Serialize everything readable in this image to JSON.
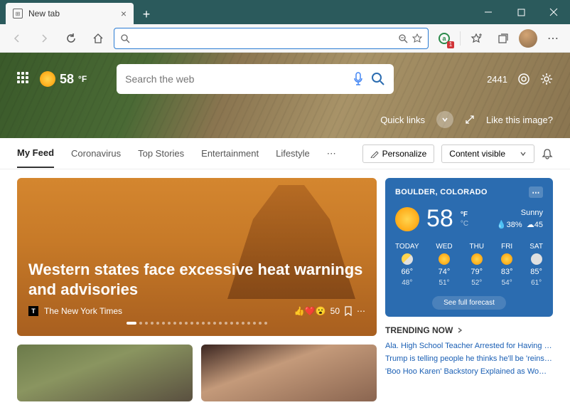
{
  "window": {
    "tab_title": "New tab"
  },
  "hero": {
    "temp": "58",
    "temp_unit": "°F",
    "search_placeholder": "Search the web",
    "points": "2441",
    "quick_links": "Quick links",
    "like_image": "Like this image?"
  },
  "nav": {
    "items": [
      "My Feed",
      "Coronavirus",
      "Top Stories",
      "Entertainment",
      "Lifestyle"
    ],
    "personalize": "Personalize",
    "content_visible": "Content visible"
  },
  "hero_card": {
    "headline": "Western states face excessive heat warnings and advisories",
    "source": "The New York Times",
    "reaction_count": "50"
  },
  "weather": {
    "location": "BOULDER, COLORADO",
    "temp": "58",
    "unit_f": "°F",
    "unit_c": "°C",
    "condition": "Sunny",
    "humidity": "38%",
    "wind": "45",
    "days": [
      {
        "label": "TODAY",
        "icon": "partly",
        "hi": "66°",
        "lo": "48°"
      },
      {
        "label": "WED",
        "icon": "sun",
        "hi": "74°",
        "lo": "51°"
      },
      {
        "label": "THU",
        "icon": "sun",
        "hi": "79°",
        "lo": "52°"
      },
      {
        "label": "FRI",
        "icon": "sun",
        "hi": "83°",
        "lo": "54°"
      },
      {
        "label": "SAT",
        "icon": "cloud",
        "hi": "85°",
        "lo": "61°"
      }
    ],
    "see_full": "See full forecast"
  },
  "trending": {
    "title": "TRENDING NOW",
    "items": [
      "Ala. High School Teacher Arrested for Having Sex…",
      "Trump is telling people he thinks he'll be 'reinstat…",
      "'Boo Hoo Karen' Backstory Explained as Woman …"
    ]
  }
}
